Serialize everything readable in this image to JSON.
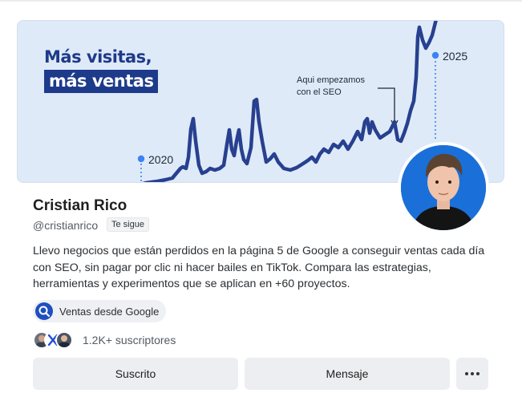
{
  "banner": {
    "headline_line1": "Más visitas,",
    "headline_line2": "más ventas",
    "year_start": "2020",
    "year_end": "2025",
    "annotation_line1": "Aqui empezamos",
    "annotation_line2": "con el SEO",
    "colors": {
      "background": "#dfeaf8",
      "line": "#1e3a8a",
      "dot": "#3b82f6"
    }
  },
  "profile": {
    "name": "Cristian Rico",
    "handle": "@cristianrico",
    "follows_badge": "Te sigue",
    "bio": "Llevo negocios que están perdidos en la página 5 de Google a conseguir ventas cada día con SEO, sin pagar por clic ni hacer bailes en TikTok. Compara las estrategias, herramientas y experimentos que se aplican en +60 proyectos.",
    "publication": {
      "label": "Ventas desde Google",
      "icon": "search-icon"
    },
    "subscribers": "1.2K+ suscriptores"
  },
  "actions": {
    "subscribed_label": "Suscrito",
    "message_label": "Mensaje",
    "more_icon": "more-dots-icon"
  }
}
